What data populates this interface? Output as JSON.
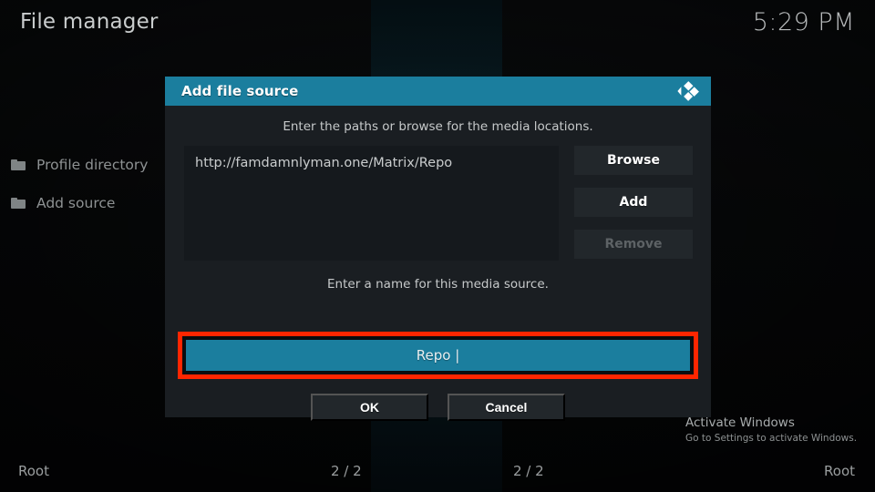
{
  "window": {
    "title": "File manager",
    "clock": "5:29 PM"
  },
  "sidebar": {
    "items": [
      {
        "label": "Profile directory",
        "icon": "folder-icon"
      },
      {
        "label": "Add source",
        "icon": "folder-icon"
      }
    ]
  },
  "dialog": {
    "title": "Add file source",
    "logo_icon": "kodi-logo-icon",
    "hint_paths": "Enter the paths or browse for the media locations.",
    "paths": [
      "http://famdamnlyman.one/Matrix/Repo"
    ],
    "side_buttons": [
      {
        "label": "Browse",
        "enabled": true
      },
      {
        "label": "Add",
        "enabled": true
      },
      {
        "label": "Remove",
        "enabled": false
      }
    ],
    "hint_name": "Enter a name for this media source.",
    "name_field": {
      "value": "Repo",
      "caret": "|",
      "display": "Repo |",
      "focused": true,
      "highlight_color": "#ff2600"
    },
    "footer_buttons": [
      {
        "label": "OK"
      },
      {
        "label": "Cancel"
      }
    ]
  },
  "statusbar": {
    "left": "Root",
    "middle_left": "2 / 2",
    "middle_right": "2 / 2",
    "right": "Root"
  },
  "watermark": {
    "title": "Activate Windows",
    "subtitle": "Go to Settings to activate Windows."
  },
  "colors": {
    "accent_teal": "#1b7e9e",
    "dialog_bg": "#1a1e22",
    "button_bg": "#22272b",
    "annotation_red": "#ff2600"
  }
}
